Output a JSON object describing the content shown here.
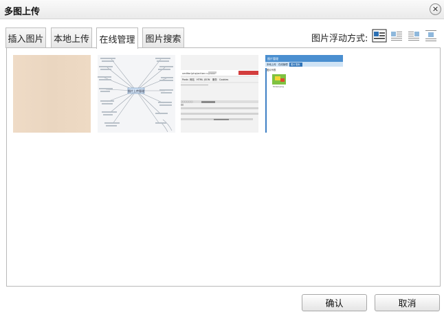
{
  "dialog": {
    "title": "多图上传",
    "close_symbol": "✕"
  },
  "tabs": [
    {
      "label": "插入图片",
      "active": false
    },
    {
      "label": "本地上传",
      "active": false
    },
    {
      "label": "在线管理",
      "active": true
    },
    {
      "label": "图片搜索",
      "active": false
    }
  ],
  "float": {
    "label": "图片浮动方式:",
    "options": [
      {
        "icon": "align-none-icon",
        "selected": true
      },
      {
        "icon": "align-left-icon",
        "selected": false
      },
      {
        "icon": "align-right-icon",
        "selected": false
      },
      {
        "icon": "align-center-icon",
        "selected": false
      }
    ]
  },
  "images": [
    {
      "kind": "beige-texture"
    },
    {
      "kind": "mind-map",
      "center_label": "图片上传管理"
    },
    {
      "kind": "webpage-screenshot",
      "url_text": "ueditor/php/action=upload",
      "nav": [
        "Posts",
        "网站",
        "HTML",
        "JSON",
        "服务",
        "Cookies"
      ]
    },
    {
      "kind": "manager-screenshot",
      "header": "图片管理",
      "tabs": [
        "本地上传",
        "在线管理",
        "图片搜索"
      ],
      "path": "图片列表",
      "thumb_caption": "Screen.png"
    }
  ],
  "actions": {
    "ok_label": "确认",
    "cancel_label": "取消"
  },
  "colors": {
    "accent_blue": "#4a8fd0",
    "selected_border": "#333333"
  }
}
